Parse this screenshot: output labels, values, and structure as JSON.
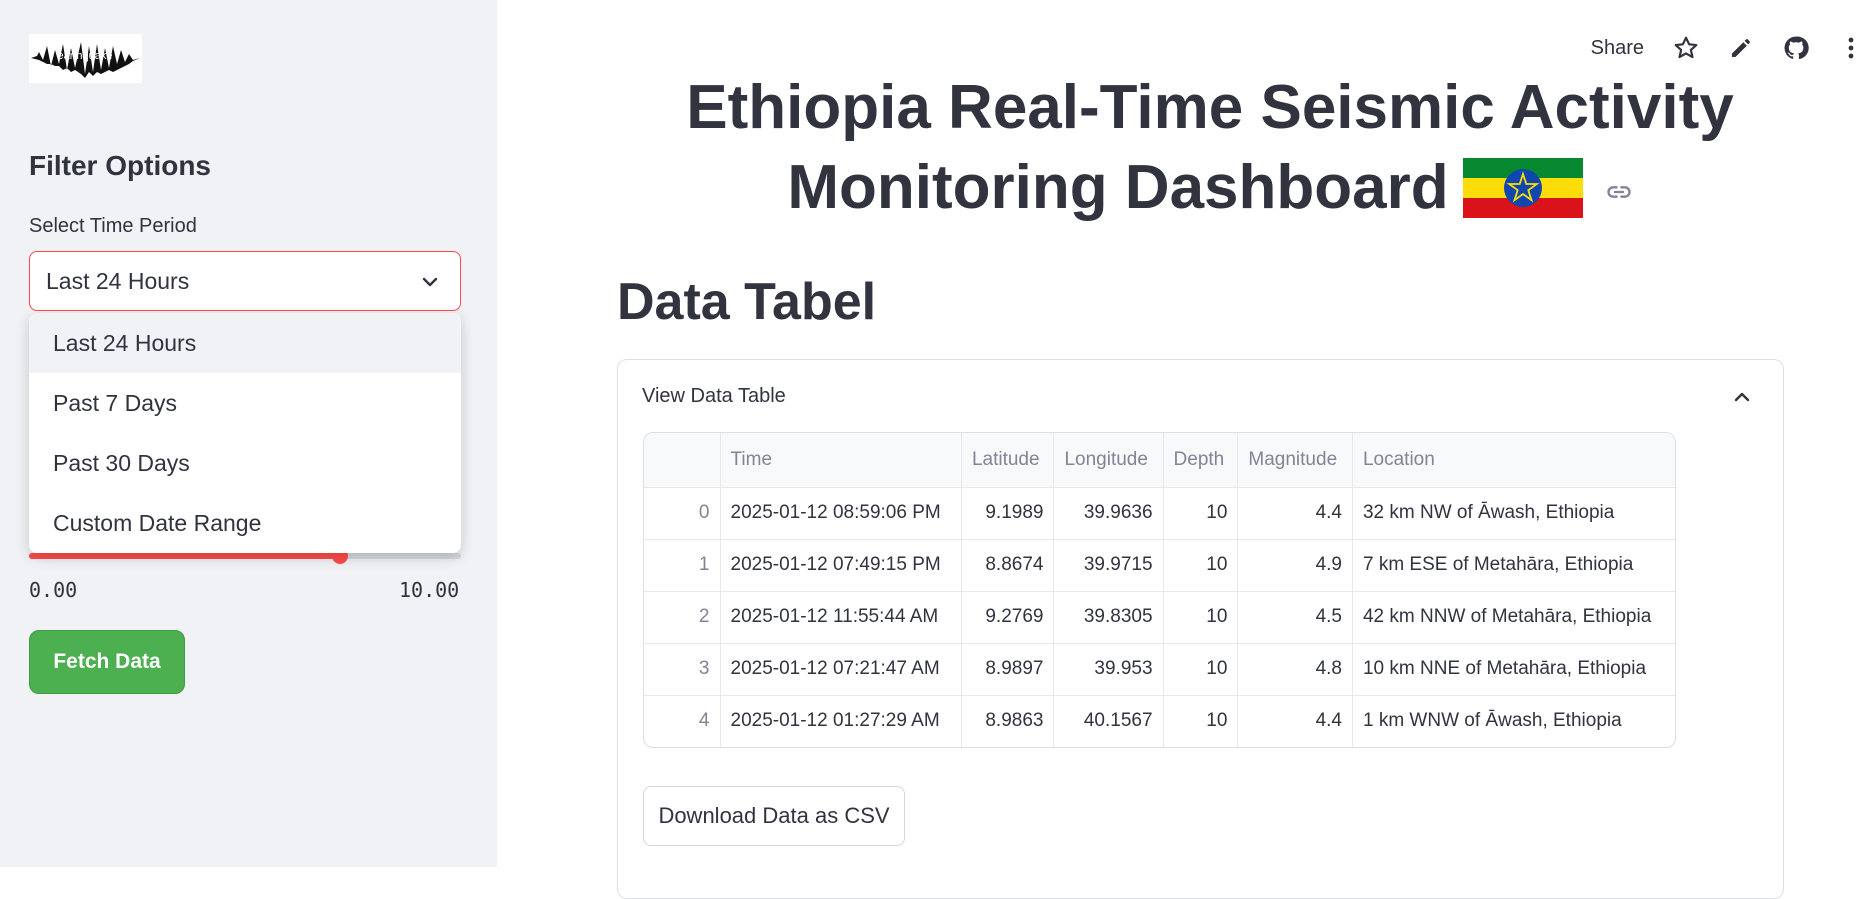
{
  "sidebar": {
    "logo_text": "earthquake",
    "filter_title": "Filter Options",
    "select_label": "Select Time Period",
    "select_value": "Last 24 Hours",
    "dropdown_options": [
      "Last 24 Hours",
      "Past 7 Days",
      "Past 30 Days",
      "Custom Date Range"
    ],
    "slider": {
      "min_label": "0.00",
      "max_label": "10.00",
      "value_fraction": 0.72
    },
    "fetch_label": "Fetch Data"
  },
  "toolbar": {
    "share_label": "Share"
  },
  "title": {
    "line1": "Ethiopia Real-Time Seismic Activity",
    "line2": "Monitoring Dashboard"
  },
  "section_title": "Data Tabel",
  "expander": {
    "label": "View Data Table"
  },
  "table": {
    "columns": [
      "",
      "Time",
      "Latitude",
      "Longitude",
      "Depth",
      "Magnitude",
      "Location"
    ],
    "rows": [
      [
        "0",
        "2025-01-12 08:59:06 PM",
        "9.1989",
        "39.9636",
        "10",
        "4.4",
        "32 km NW of Āwash, Ethiopia"
      ],
      [
        "1",
        "2025-01-12 07:49:15 PM",
        "8.8674",
        "39.9715",
        "10",
        "4.9",
        "7 km ESE of Metahāra, Ethiopia"
      ],
      [
        "2",
        "2025-01-12 11:55:44 AM",
        "9.2769",
        "39.8305",
        "10",
        "4.5",
        "42 km NNW of Metahāra, Ethiopia"
      ],
      [
        "3",
        "2025-01-12 07:21:47 AM",
        "8.9897",
        "39.953",
        "10",
        "4.8",
        "10 km NNE of Metahāra, Ethiopia"
      ],
      [
        "4",
        "2025-01-12 01:27:29 AM",
        "8.9863",
        "40.1567",
        "10",
        "4.4",
        "1 km WNW of Āwash, Ethiopia"
      ]
    ]
  },
  "download_label": "Download Data as CSV",
  "colors": {
    "accent": "#ff4b4b",
    "fetch_green": "#4caf50",
    "flag_green": "#078930",
    "flag_yellow": "#fcdd09",
    "flag_red": "#da121a",
    "flag_blue": "#0f47af"
  },
  "icons": [
    "star-icon",
    "pencil-icon",
    "github-icon",
    "more-vert-icon",
    "link-icon",
    "chevron-down-icon",
    "chevron-up-icon"
  ]
}
